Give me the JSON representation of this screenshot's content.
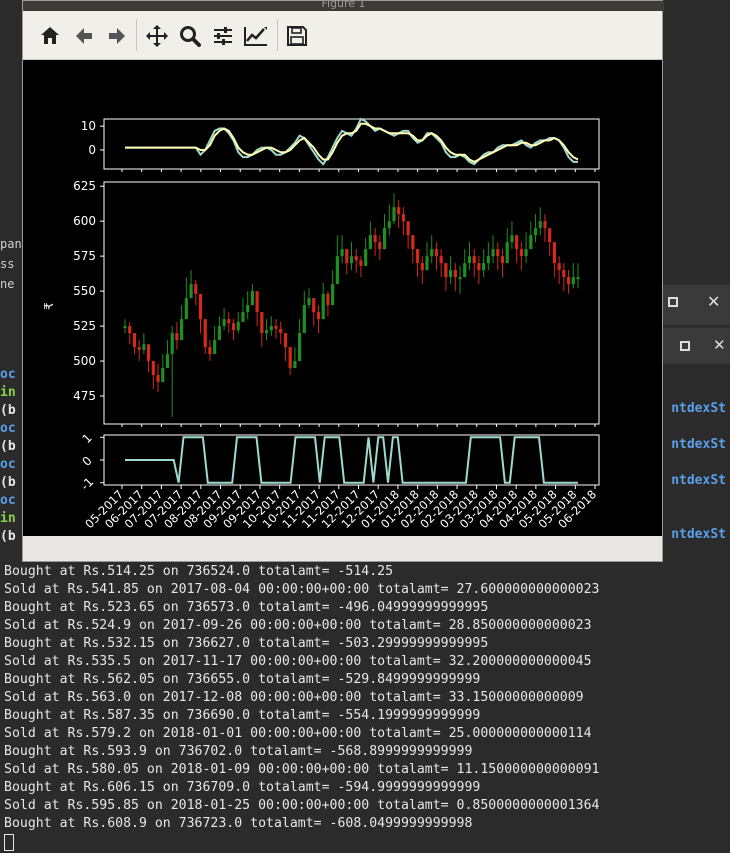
{
  "figure": {
    "title": "Figure 1",
    "toolbar": [
      {
        "icon": "home-icon"
      },
      {
        "icon": "back-arrow-icon"
      },
      {
        "icon": "forward-arrow-icon"
      },
      {
        "icon": "pan-icon"
      },
      {
        "icon": "zoom-icon"
      },
      {
        "icon": "subplots-icon"
      },
      {
        "icon": "edit-axes-icon"
      },
      {
        "icon": "save-icon"
      }
    ]
  },
  "chart_data": [
    {
      "type": "line",
      "yticks": [
        "10",
        "0"
      ],
      "series": [
        {
          "color": "#9ed9d0",
          "values": [
            1,
            1,
            1,
            1,
            1,
            1,
            1,
            1,
            1,
            1,
            1,
            1,
            1,
            1,
            1,
            1,
            -2,
            0,
            4,
            8,
            9,
            9,
            7,
            4,
            -1,
            -3,
            -3,
            -2,
            0,
            1,
            1,
            0,
            -2,
            -2,
            -1,
            1,
            3,
            6,
            5,
            2,
            -1,
            -4,
            -6,
            -3,
            1,
            5,
            8,
            7,
            6,
            9,
            13,
            12,
            10,
            8,
            9,
            8,
            7,
            6,
            7,
            8,
            8,
            5,
            3,
            4,
            7,
            7,
            5,
            3,
            -1,
            -3,
            -3,
            -2,
            -3,
            -5,
            -6,
            -4,
            -2,
            -1,
            -1,
            1,
            2,
            2,
            2,
            3,
            4,
            2,
            1,
            3,
            4,
            4,
            5,
            5,
            4,
            1,
            -3,
            -5,
            -5
          ]
        },
        {
          "color": "#ffffb3",
          "values": [
            1,
            1,
            1,
            1,
            1,
            1,
            1,
            1,
            1,
            1,
            1,
            1,
            1,
            1,
            1,
            1,
            0,
            0,
            2,
            6,
            8,
            9,
            8,
            5,
            1,
            -1,
            -2,
            -2,
            -1,
            0,
            1,
            1,
            0,
            -1,
            -1,
            0,
            2,
            4,
            5,
            3,
            1,
            -2,
            -4,
            -4,
            -1,
            3,
            6,
            7,
            7,
            8,
            11,
            11,
            10,
            9,
            9,
            8,
            7,
            7,
            7,
            7,
            7,
            6,
            4,
            4,
            6,
            7,
            6,
            4,
            1,
            -1,
            -2,
            -2,
            -2,
            -4,
            -5,
            -4,
            -3,
            -2,
            -1,
            0,
            1,
            2,
            2,
            2,
            3,
            3,
            2,
            2,
            3,
            4,
            4,
            5,
            4,
            2,
            -1,
            -3,
            -4
          ]
        }
      ],
      "ylim": [
        -8,
        13
      ]
    },
    {
      "type": "candlestick",
      "ylabel": "₹",
      "yticks": [
        "625",
        "600",
        "575",
        "550",
        "525",
        "500",
        "475"
      ],
      "ylim": [
        455,
        628
      ],
      "up_color": "#1f8f1f",
      "down_color": "#d42a1a",
      "close": [
        525,
        520,
        510,
        508,
        512,
        500,
        490,
        485,
        495,
        505,
        520,
        515,
        530,
        545,
        555,
        548,
        530,
        510,
        505,
        515,
        525,
        530,
        527,
        522,
        528,
        535,
        540,
        550,
        535,
        520,
        522,
        525,
        523,
        520,
        510,
        495,
        500,
        520,
        540,
        545,
        535,
        530,
        548,
        540,
        555,
        575,
        580,
        570,
        575,
        572,
        568,
        580,
        590,
        585,
        580,
        595,
        600,
        610,
        605,
        600,
        590,
        580,
        570,
        565,
        575,
        580,
        575,
        570,
        560,
        565,
        560,
        560,
        570,
        575,
        570,
        565,
        570,
        575,
        580,
        575,
        570,
        585,
        590,
        580,
        575,
        580,
        590,
        595,
        600,
        595,
        585,
        570,
        565,
        560,
        555,
        560,
        560
      ],
      "ranges": [
        [
          520,
          530
        ],
        [
          512,
          528
        ],
        [
          505,
          518
        ],
        [
          500,
          515
        ],
        [
          505,
          520
        ],
        [
          492,
          510
        ],
        [
          480,
          500
        ],
        [
          478,
          498
        ],
        [
          485,
          505
        ],
        [
          495,
          515
        ],
        [
          460,
          525
        ],
        [
          508,
          528
        ],
        [
          520,
          540
        ],
        [
          535,
          560
        ],
        [
          545,
          565
        ],
        [
          540,
          558
        ],
        [
          520,
          545
        ],
        [
          505,
          520
        ],
        [
          500,
          515
        ],
        [
          508,
          525
        ],
        [
          518,
          532
        ],
        [
          522,
          538
        ],
        [
          520,
          535
        ],
        [
          515,
          530
        ],
        [
          520,
          535
        ],
        [
          528,
          545
        ],
        [
          530,
          550
        ],
        [
          540,
          555
        ],
        [
          525,
          545
        ],
        [
          510,
          530
        ],
        [
          515,
          530
        ],
        [
          518,
          532
        ],
        [
          516,
          530
        ],
        [
          512,
          528
        ],
        [
          500,
          520
        ],
        [
          490,
          505
        ],
        [
          495,
          510
        ],
        [
          510,
          530
        ],
        [
          530,
          550
        ],
        [
          538,
          552
        ],
        [
          525,
          545
        ],
        [
          520,
          540
        ],
        [
          540,
          556
        ],
        [
          532,
          550
        ],
        [
          545,
          565
        ],
        [
          560,
          590
        ],
        [
          570,
          590
        ],
        [
          562,
          580
        ],
        [
          565,
          585
        ],
        [
          563,
          580
        ],
        [
          560,
          575
        ],
        [
          570,
          588
        ],
        [
          580,
          600
        ],
        [
          575,
          595
        ],
        [
          572,
          590
        ],
        [
          585,
          605
        ],
        [
          590,
          612
        ],
        [
          598,
          620
        ],
        [
          595,
          615
        ],
        [
          590,
          610
        ],
        [
          580,
          600
        ],
        [
          570,
          590
        ],
        [
          560,
          580
        ],
        [
          555,
          575
        ],
        [
          565,
          585
        ],
        [
          570,
          590
        ],
        [
          565,
          585
        ],
        [
          560,
          580
        ],
        [
          550,
          570
        ],
        [
          555,
          575
        ],
        [
          550,
          570
        ],
        [
          548,
          568
        ],
        [
          560,
          580
        ],
        [
          565,
          585
        ],
        [
          560,
          580
        ],
        [
          555,
          575
        ],
        [
          560,
          580
        ],
        [
          565,
          585
        ],
        [
          570,
          590
        ],
        [
          565,
          585
        ],
        [
          560,
          580
        ],
        [
          575,
          595
        ],
        [
          580,
          600
        ],
        [
          570,
          590
        ],
        [
          565,
          585
        ],
        [
          570,
          592
        ],
        [
          580,
          600
        ],
        [
          585,
          605
        ],
        [
          590,
          610
        ],
        [
          585,
          605
        ],
        [
          575,
          595
        ],
        [
          560,
          580
        ],
        [
          555,
          575
        ],
        [
          550,
          570
        ],
        [
          548,
          565
        ],
        [
          552,
          570
        ],
        [
          552,
          570
        ]
      ]
    },
    {
      "type": "line",
      "color": "#9ed9d0",
      "yticks": [
        "1",
        "0",
        "-1"
      ],
      "xticks": [
        "05-2017",
        "06-2017",
        "07-2017",
        "08-2017",
        "09-2017",
        "10-2017",
        "11-2017",
        "12-2017",
        "01-2018",
        "02-2018",
        "03-2018",
        "04-2018",
        "05-2018",
        "06-2018"
      ],
      "xtick_labels": [
        "05-2017",
        "06-2017",
        "07-2017",
        "07-2017",
        "08-2017",
        "08-2017",
        "09-2017",
        "09-2017",
        "10-2017",
        "10-2017",
        "11-2017",
        "11-2017",
        "12-2017",
        "12-2017",
        "01-2018",
        "01-2018",
        "02-2018",
        "02-2018",
        "03-2018",
        "03-2018",
        "04-2018",
        "04-2018",
        "05-2018",
        "05-2018",
        "06-2018"
      ],
      "values": [
        0,
        0,
        0,
        0,
        0,
        0,
        0,
        0,
        0,
        0,
        0,
        -1,
        1,
        1,
        1,
        1,
        1,
        -1,
        -1,
        -1,
        -1,
        -1,
        -1,
        1,
        1,
        1,
        1,
        1,
        -1,
        -1,
        -1,
        -1,
        -1,
        -1,
        -1,
        1,
        1,
        1,
        1,
        1,
        -1,
        1,
        1,
        1,
        1,
        -1,
        -1,
        -1,
        -1,
        -1,
        1,
        -1,
        1,
        1,
        -1,
        1,
        1,
        -1,
        -1,
        -1,
        -1,
        -1,
        -1,
        -1,
        -1,
        -1,
        -1,
        -1,
        -1,
        -1,
        -1,
        1,
        1,
        1,
        1,
        1,
        1,
        1,
        -1,
        -1,
        1,
        1,
        1,
        1,
        1,
        1,
        -1,
        -1,
        -1,
        -1,
        -1,
        -1,
        -1,
        -1
      ],
      "ylim": [
        -1.1,
        1.1
      ]
    }
  ],
  "terminal": {
    "behind_lines": [
      {
        "text": "oc",
        "color": "#5aa0e8"
      },
      {
        "text": "in",
        "color": "#8bd04a"
      },
      {
        "text": "(b",
        "color": "#e6e6e6"
      },
      {
        "text": "oc",
        "color": "#5aa0e8"
      },
      {
        "text": "(b",
        "color": "#e6e6e6"
      },
      {
        "text": "oc",
        "color": "#5aa0e8"
      },
      {
        "text": "(b",
        "color": "#e6e6e6"
      },
      {
        "text": "oc",
        "color": "#5aa0e8"
      },
      {
        "text": "in",
        "color": "#8bd04a"
      },
      {
        "text": "(b",
        "color": "#e6e6e6"
      }
    ],
    "right_fragments": [
      "ntdexSt",
      "ntdexSt",
      "ntdexSt",
      "ntdexSt"
    ],
    "left_fragments": [
      "pany",
      "ss C",
      "ne"
    ],
    "output": [
      "Bought at Rs.514.25 on 736524.0 totalamt= -514.25",
      "Sold at Rs.541.85 on 2017-08-04 00:00:00+00:00 totalamt= 27.600000000000023",
      "Bought at Rs.523.65 on 736573.0 totalamt= -496.04999999999995",
      "Sold at Rs.524.9 on 2017-09-26 00:00:00+00:00 totalamt= 28.850000000000023",
      "Bought at Rs.532.15 on 736627.0 totalamt= -503.29999999999995",
      "Sold at Rs.535.5 on 2017-11-17 00:00:00+00:00 totalamt= 32.200000000000045",
      "Bought at Rs.562.05 on 736655.0 totalamt= -529.8499999999999",
      "Sold at Rs.563.0 on 2017-12-08 00:00:00+00:00 totalamt= 33.15000000000009",
      "Bought at Rs.587.35 on 736690.0 totalamt= -554.1999999999999",
      "Sold at Rs.579.2 on 2018-01-01 00:00:00+00:00 totalamt= 25.000000000000114",
      "Bought at Rs.593.9 on 736702.0 totalamt= -568.8999999999999",
      "Sold at Rs.580.05 on 2018-01-09 00:00:00+00:00 totalamt= 11.150000000000091",
      "Bought at Rs.606.15 on 736709.0 totalamt= -594.9999999999999",
      "Sold at Rs.595.85 on 2018-01-25 00:00:00+00:00 totalamt= 0.8500000000001364",
      "Bought at Rs.608.9 on 736723.0 totalamt= -608.0499999999998"
    ]
  }
}
